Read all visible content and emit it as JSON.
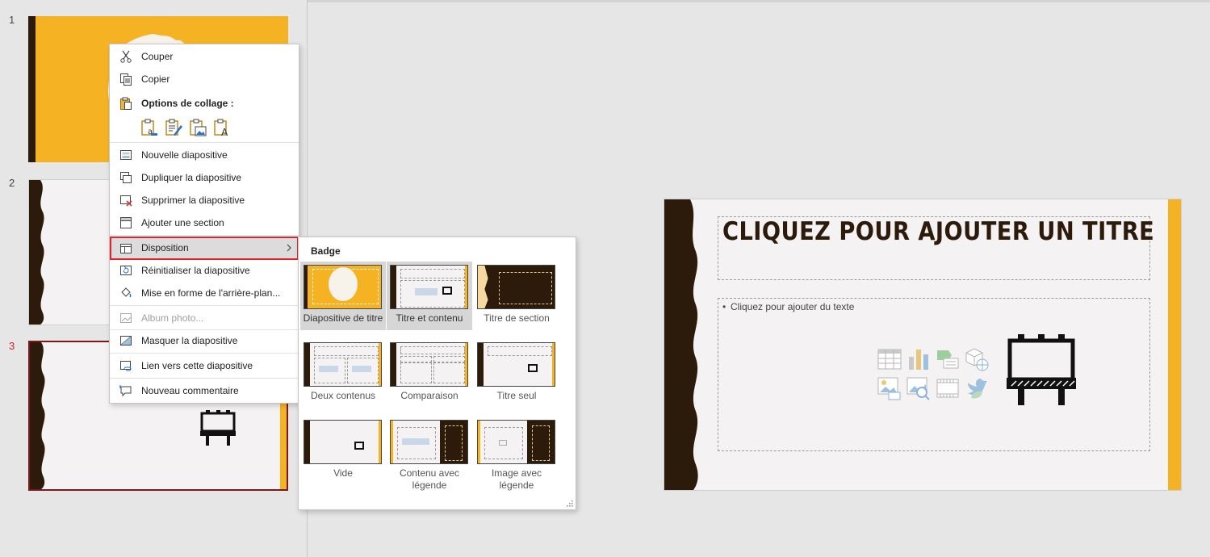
{
  "colors": {
    "accent": "#f5b324",
    "dark": "#2c1a0b",
    "selection_border": "#7a1a1f",
    "highlight_border": "#e3242b"
  },
  "thumbnails": [
    {
      "number": "1",
      "layout": "title"
    },
    {
      "number": "2",
      "layout": "wave"
    },
    {
      "number": "3",
      "layout": "billboard",
      "selected": true
    }
  ],
  "context_menu": {
    "cut": "Couper",
    "copy": "Copier",
    "paste_options": "Options de collage :",
    "paste_icons": [
      "paste-use-destination-icon",
      "paste-keep-formatting-icon",
      "paste-picture-icon",
      "paste-text-only-icon"
    ],
    "new_slide": "Nouvelle diapositive",
    "duplicate_slide": "Dupliquer la diapositive",
    "delete_slide": "Supprimer la diapositive",
    "add_section": "Ajouter une section",
    "layout": "Disposition",
    "reset_slide": "Réinitialiser la diapositive",
    "format_background": "Mise en forme de l'arrière-plan...",
    "photo_album": "Album photo...",
    "hide_slide": "Masquer la diapositive",
    "link_to_slide": "Lien vers cette diapositive",
    "new_comment": "Nouveau commentaire"
  },
  "layout_gallery": {
    "theme_name": "Badge",
    "layouts": [
      {
        "label": "Diapositive de titre",
        "selected": true
      },
      {
        "label": "Titre et contenu",
        "hover": true
      },
      {
        "label": "Titre de section"
      },
      {
        "label": "Deux contenus"
      },
      {
        "label": "Comparaison"
      },
      {
        "label": "Titre seul"
      },
      {
        "label": "Vide"
      },
      {
        "label": "Contenu avec légende"
      },
      {
        "label": "Image avec légende"
      }
    ]
  },
  "slide": {
    "title_placeholder": "CLIQUEZ POUR AJOUTER UN TITRE",
    "bullet": "•",
    "body_placeholder": "Cliquez pour ajouter du texte",
    "content_icons": [
      "insert-table-icon",
      "insert-chart-icon",
      "insert-smartart-icon",
      "insert-3d-model-icon",
      "insert-picture-icon",
      "insert-online-picture-icon",
      "insert-video-icon",
      "insert-icons-icon"
    ]
  }
}
